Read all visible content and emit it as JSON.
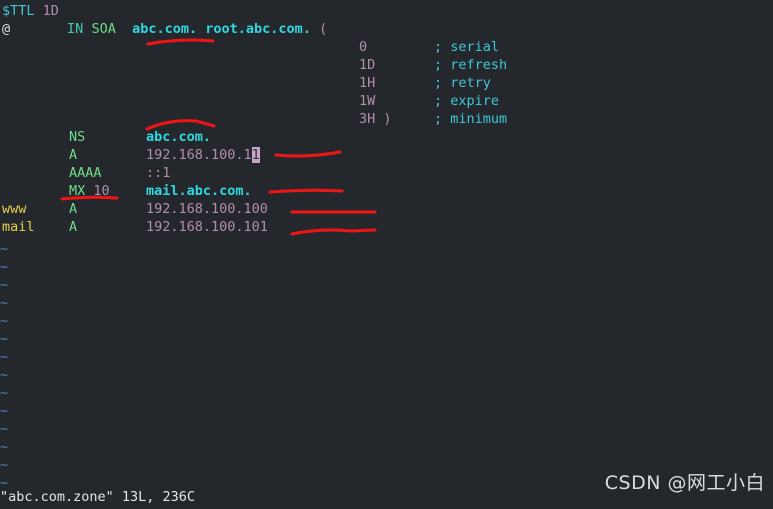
{
  "terminal": {
    "background": "#24282c",
    "cursor_color": "#c9a5c9",
    "annotation_color": "#f01414"
  },
  "file": {
    "name": "abc.com.zone",
    "lines_label": "13L",
    "chars_label": "236C",
    "status_text": "\"abc.com.zone\" 13L, 236C"
  },
  "zone": {
    "ttl_directive": "$TTL",
    "ttl_value": "1D",
    "soa": {
      "owner": "@",
      "class": "IN",
      "type": "SOA",
      "primary_ns": "abc.com.",
      "rname": "root.abc.com.",
      "open_paren": "(",
      "close_paren": ")",
      "fields": [
        {
          "value": "0",
          "semicolon": ";",
          "comment": "serial"
        },
        {
          "value": "1D",
          "semicolon": ";",
          "comment": "refresh"
        },
        {
          "value": "1H",
          "semicolon": ";",
          "comment": "retry"
        },
        {
          "value": "1W",
          "semicolon": ";",
          "comment": "expire"
        },
        {
          "value": "3H",
          "semicolon": ";",
          "comment": "minimum"
        }
      ]
    },
    "records": [
      {
        "owner": "",
        "type": "NS",
        "pref": "",
        "data": "abc.com.",
        "data_style": "domain"
      },
      {
        "owner": "",
        "type": "A",
        "pref": "",
        "data": "192.168.100.11",
        "data_style": "value"
      },
      {
        "owner": "",
        "type": "AAAA",
        "pref": "",
        "data": "::1",
        "data_style": "value"
      },
      {
        "owner": "",
        "type": "MX",
        "pref": "10",
        "data": "mail.abc.com.",
        "data_style": "domain"
      },
      {
        "owner": "www",
        "type": "A",
        "pref": "",
        "data": "192.168.100.100",
        "data_style": "value"
      },
      {
        "owner": "mail",
        "type": "A",
        "pref": "",
        "data": "192.168.100.101",
        "data_style": "value"
      }
    ],
    "cursor_char": "1"
  },
  "empty_lines": {
    "marker": "~",
    "count": 14
  },
  "watermark": {
    "text": "CSDN @网工小白"
  }
}
